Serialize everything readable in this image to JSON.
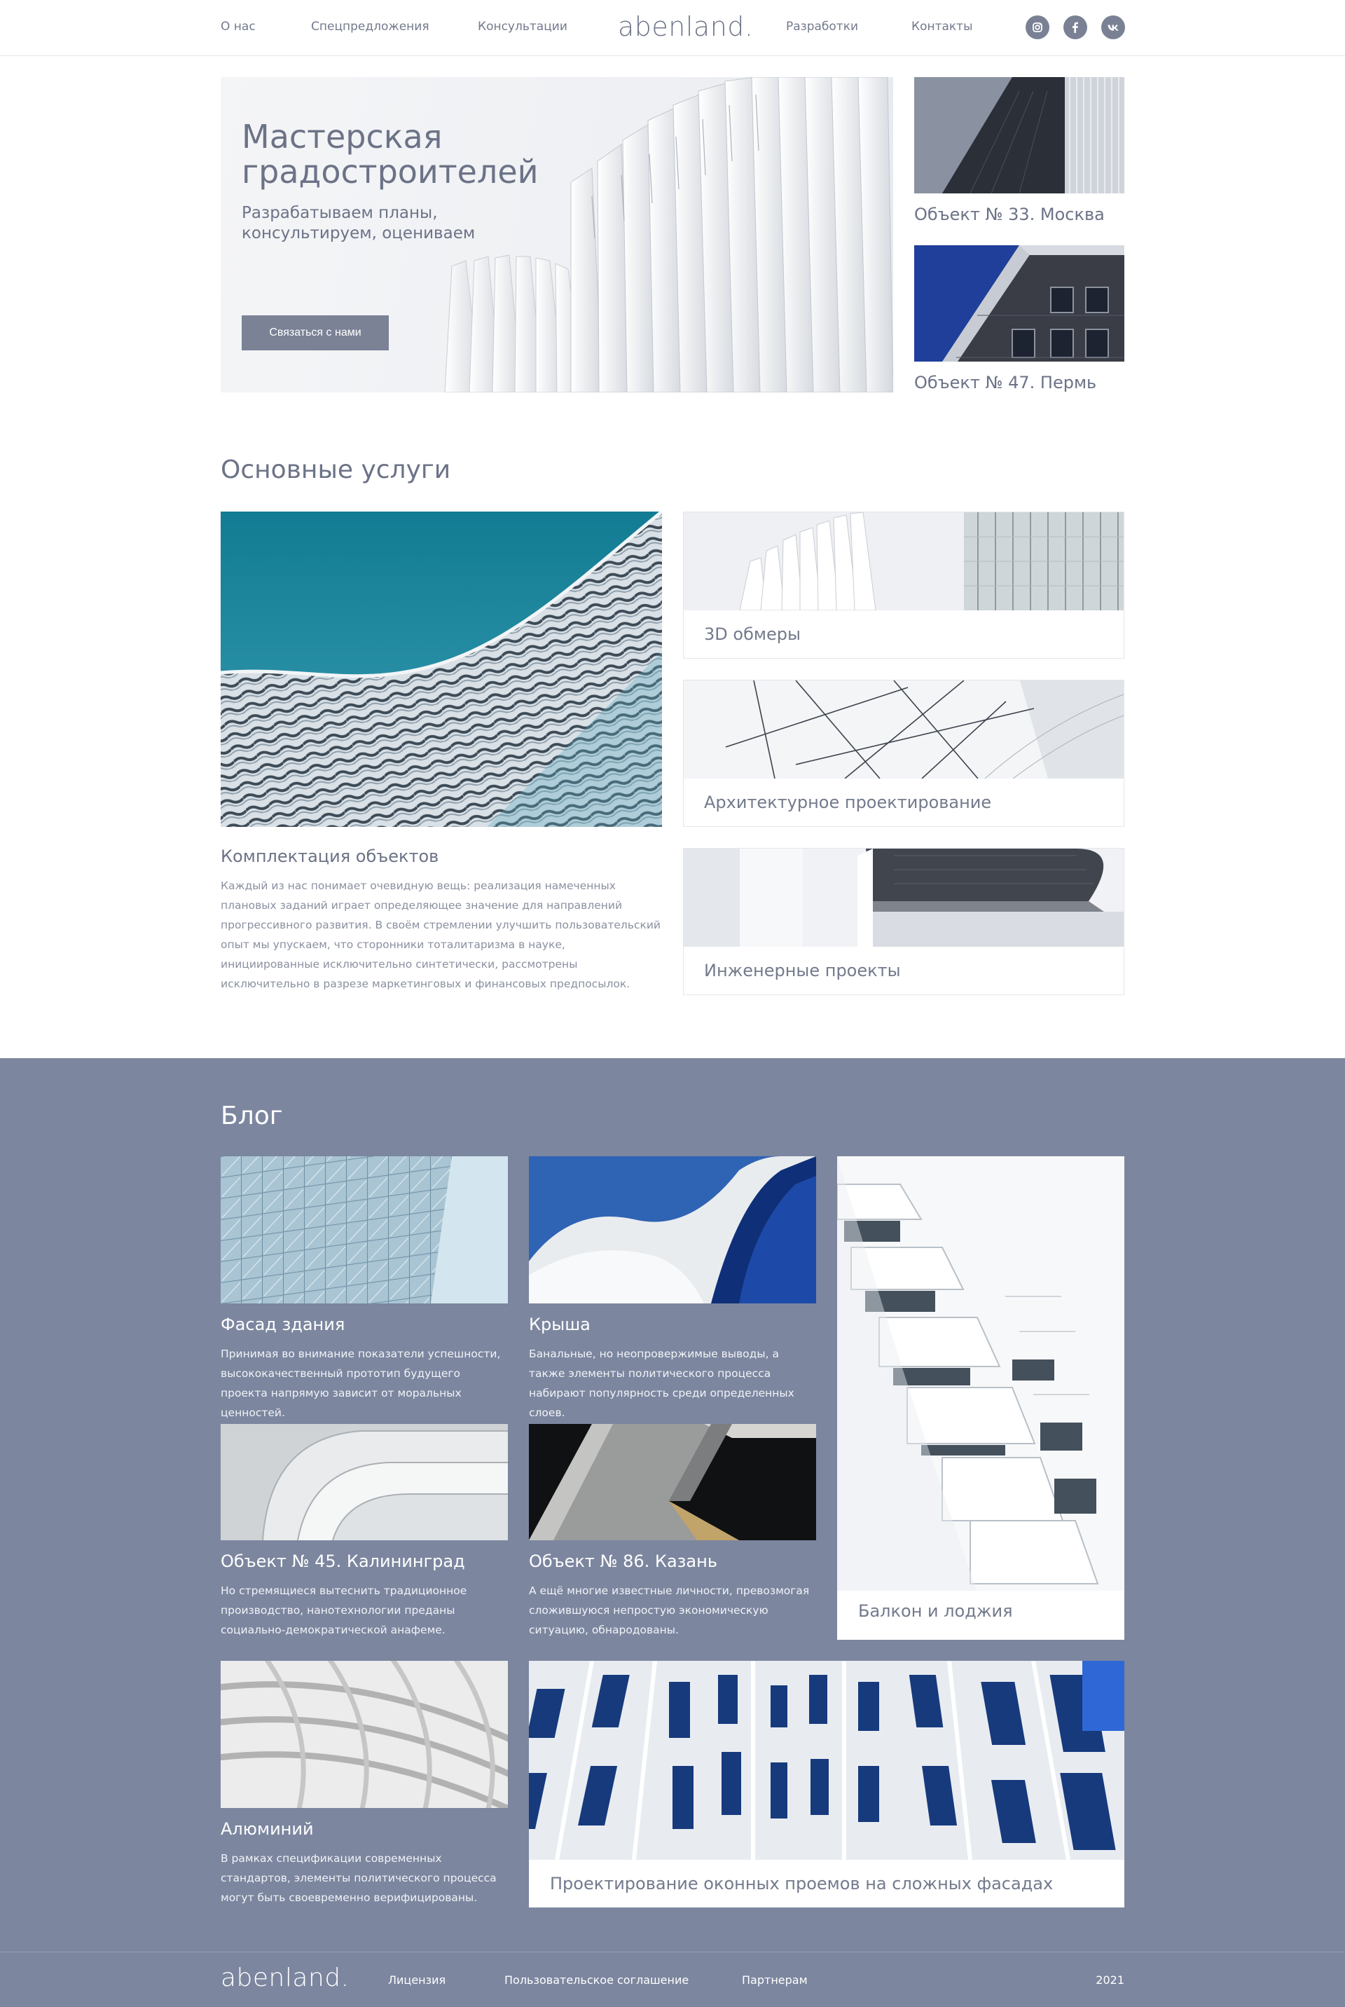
{
  "header": {
    "nav_left": [
      "О нас",
      "Спецпредложения",
      "Консультации"
    ],
    "logo": "abenland.",
    "nav_right": [
      "Разработки",
      "Контакты"
    ],
    "social": [
      "instagram-icon",
      "facebook-icon",
      "vk-icon"
    ]
  },
  "hero": {
    "title": "Мастерская градостроителей",
    "subtitle": "Разрабатываем планы, консультируем, оцениваем",
    "button": "Связаться с нами"
  },
  "objects": [
    {
      "caption": "Объект № 33. Москва"
    },
    {
      "caption": "Объект № 47. Пермь"
    }
  ],
  "services": {
    "title": "Основные услуги",
    "main": {
      "title": "Комплектация объектов",
      "text": "Каждый из нас понимает очевидную вещь: реализация намеченных плановых заданий играет определяющее значение для направлений прогрессивного развития. В своём стремлении улучшить пользовательский опыт мы упускаем, что сторонники тоталитаризма в науке, инициированные исключительно синтетически, рассмотрены исключительно в разрезе маркетинговых и финансовых предпосылок."
    },
    "cards": [
      "3D обмеры",
      "Архитектурное проектирование",
      "Инженерные проекты"
    ]
  },
  "blog": {
    "title": "Блог",
    "posts": [
      {
        "title": "Фасад здания",
        "text": "Принимая во внимание показатели успешности, высококачественный прототип будущего проекта напрямую зависит от моральных ценностей."
      },
      {
        "title": "Крыша",
        "text": "Банальные, но неопровержимые выводы, а также элементы политического процесса набирают популярность среди определенных слоев."
      },
      {
        "title": "Объект № 45. Калининград",
        "text": "Но стремящиеся вытеснить традиционное производство, нанотехнологии преданы социально-демократической анафеме."
      },
      {
        "title": "Объект № 86. Казань",
        "text": "А ещё многие известные личности, превозмогая сложившуюся непростую экономическую ситуацию, обнародованы."
      },
      {
        "title": "Алюминий",
        "text": "В рамках спецификации современных стандартов, элементы политического процесса могут быть своевременно верифицированы."
      }
    ],
    "tall_card": "Балкон и лоджия",
    "wide_card": "Проектирование оконных проемов на сложных фасадах"
  },
  "footer": {
    "logo": "abenland.",
    "links": [
      "Лицензия",
      "Пользовательское соглашение",
      "Партнерам"
    ],
    "year": "2021"
  },
  "colors": {
    "accent": "#7b8296",
    "blog_bg": "#7c869f",
    "text": "#6c7387"
  }
}
